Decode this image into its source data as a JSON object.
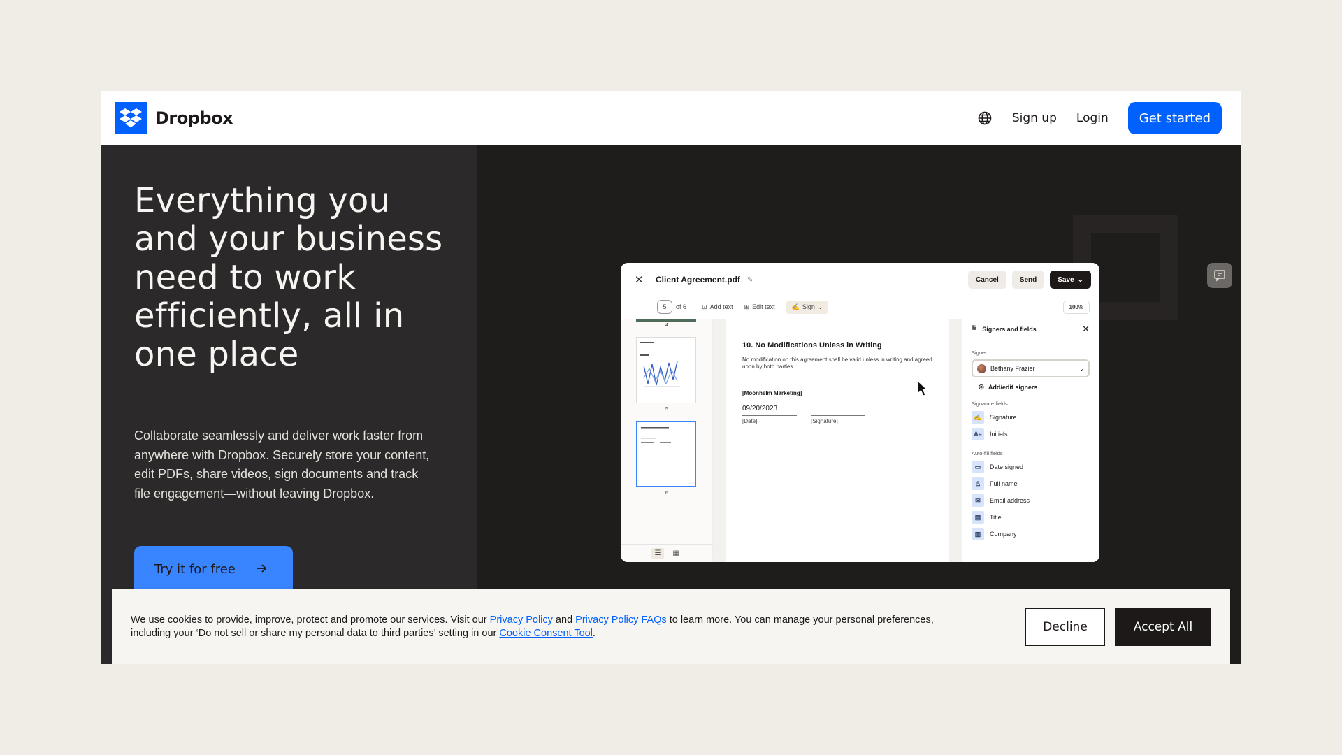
{
  "colors": {
    "brand": "#0061fe",
    "page_bg": "#f0ece6",
    "hero_left": "#2b2929",
    "hero_right": "#1f1d1c",
    "try_button": "#3984ff"
  },
  "header": {
    "logo_text": "Dropbox",
    "logo_icon": "dropbox-logo-icon",
    "globe_icon": "globe-icon",
    "signup_label": "Sign up",
    "login_label": "Login",
    "cta_label": "Get started"
  },
  "hero": {
    "headline": "Everything you and your business need to work efficiently, all in one place",
    "subtext": "Collaborate seamlessly and deliver work faster from anywhere with Dropbox. Securely store your content, edit PDFs, share videos, sign documents and track file engagement—without leaving Dropbox.",
    "try_label": "Try it for free",
    "try_icon": "arrow-right-icon"
  },
  "app": {
    "file_title": "Client Agreement.pdf",
    "cancel_label": "Cancel",
    "send_label": "Send",
    "save_label": "Save",
    "page_current": "5",
    "page_of": "of 6",
    "add_text_label": "Add text",
    "edit_text_label": "Edit text",
    "sign_label": "Sign",
    "zoom_label": "100%",
    "thumb_numbers": [
      "4",
      "5",
      "6"
    ],
    "doc": {
      "heading": "10. No Modifications Unless in Writing",
      "body": "No modification on this agreement shall be valid unless in writing and agreed upon by both parties.",
      "company": "[Moonhelm Marketing]",
      "date_value": "09/20/2023",
      "date_label": "[Date]",
      "signature_label": "[Signature]"
    },
    "panel": {
      "title": "Signers and fields",
      "signer_section": "Signer",
      "signer_name": "Bethany Frazier",
      "add_signers": "Add/edit signers",
      "signature_section": "Signature fields",
      "signature_fields": [
        "Signature",
        "Initials"
      ],
      "autofill_section": "Auto-fill fields",
      "autofill_fields": [
        "Date signed",
        "Full name",
        "Email address",
        "Title",
        "Company"
      ]
    }
  },
  "cookie": {
    "text_1": "We use cookies to provide, improve, protect and promote our services. Visit our ",
    "link_privacy": "Privacy Policy",
    "text_2": " and ",
    "link_faqs": "Privacy Policy FAQs",
    "text_3": " to learn more. You can manage your personal preferences, including your ‘Do not sell or share my personal data to third parties’ setting in our ",
    "link_tool": "Cookie Consent Tool",
    "text_4": ".",
    "decline_label": "Decline",
    "accept_label": "Accept All"
  }
}
